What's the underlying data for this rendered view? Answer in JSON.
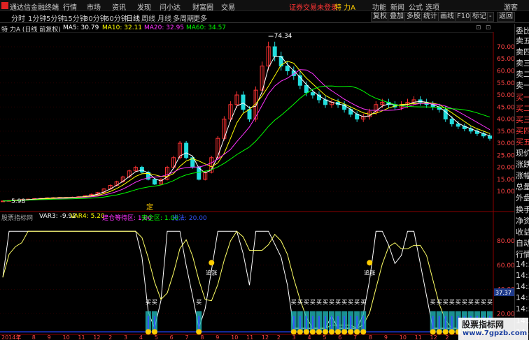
{
  "app": {
    "title": "通达信金融终端",
    "menu": [
      "行情",
      "市场",
      "资讯",
      "发现",
      "问小达",
      "财富圈",
      "交易"
    ],
    "login_status": "证券交易未登录",
    "stock_name": "特 力A",
    "right_menu": [
      "功能",
      "新闻",
      "公式",
      "选项",
      "游客"
    ]
  },
  "toolbar": {
    "periods": [
      "分时",
      "1分钟",
      "5分钟",
      "15分钟",
      "30分钟",
      "60分钟",
      "日线",
      "周线",
      "月线",
      "多周期",
      "更多"
    ],
    "active_period": "日线",
    "buttons": [
      "复权",
      "叠加",
      "多股",
      "统计",
      "画线",
      "F10",
      "标记",
      "-",
      "返回"
    ]
  },
  "main_info": {
    "title": "特 力A (日线 前复权)",
    "ma5": "MA5: 30.79",
    "ma10": "MA10: 32.11",
    "ma20": "MA20: 32.95",
    "ma60": "MA60: 34.57",
    "ma5_color": "#ffffff",
    "ma10_color": "#ffff00",
    "ma20_color": "#ff33ff",
    "ma60_color": "#00ff00"
  },
  "chart_data": {
    "type": "candlestick",
    "price_axis": [
      "70.00",
      "65.00",
      "60.00",
      "55.00",
      "50.00",
      "45.00",
      "40.00",
      "35.00",
      "30.00",
      "25.00",
      "20.00",
      "15.00",
      "10.00"
    ],
    "high_label": "74.34",
    "low_label": "5.98",
    "current_price_label": "37.37",
    "marker": "定",
    "close_series": [
      6.0,
      6.2,
      6.4,
      6.6,
      6.8,
      7.0,
      7.1,
      7.3,
      7.4,
      7.5,
      7.5,
      7.6,
      7.8,
      8.2,
      8.8,
      9.5,
      11.0,
      12.5,
      14.0,
      16.0,
      18.5,
      20.0,
      18.0,
      15.0,
      13.0,
      15.0,
      20.0,
      24.0,
      30.0,
      24.0,
      20.0,
      15.0,
      18.0,
      24.0,
      32.0,
      40.0,
      46.0,
      50.0,
      44.0,
      40.0,
      52.0,
      62.0,
      70.0,
      66.0,
      62.0,
      60.0,
      58.0,
      54.0,
      51.0,
      50.0,
      48.0,
      46.0,
      47.0,
      46.0,
      44.0,
      42.0,
      40.0,
      41.0,
      43.0,
      46.0,
      47.0,
      46.0,
      45.0,
      46.0,
      47.0,
      48.0,
      47.0,
      46.0,
      45.0,
      44.0,
      40.0,
      38.0,
      37.0,
      36.0,
      35.0,
      34.0,
      33.0,
      32.0
    ]
  },
  "indicator": {
    "name": "股票指标网",
    "var3": "VAR3: -9.92",
    "var4": "VAR4: 5.20",
    "wait_zone": "建仓等待区: 1.00",
    "safe_zone": "安全区: 1.00",
    "danger": "光法: 20.00",
    "axis": [
      "80.00",
      "60.00",
      "40.00",
      "20.00"
    ],
    "current_value": "37.37",
    "chase_label": "追涨",
    "buy_label": "买",
    "chase_signals": 9,
    "buy_signals": 11
  },
  "time_axis": [
    "2014年",
    "7",
    "8",
    "9",
    "10",
    "11",
    "12",
    "2",
    "3",
    "4",
    "5",
    "6",
    "7",
    "8",
    "9",
    "10",
    "11",
    "12",
    "2",
    "3",
    "4",
    "5",
    "6",
    "7",
    "8",
    "9",
    "10",
    "11",
    "12",
    "2",
    "3",
    "4"
  ],
  "right_panel": {
    "header": "委比",
    "items": [
      "卖五",
      "卖四",
      "卖三",
      "卖二",
      "卖一",
      "买一",
      "买二",
      "买三",
      "买四",
      "买五",
      "现价",
      "涨跌",
      "涨幅",
      "总量",
      "外盘",
      "换手",
      "净资",
      "收益",
      "自动",
      "行情",
      "14:5",
      "14:5",
      "14:5",
      "14:5",
      "14:5",
      "14:5",
      "14:5"
    ]
  },
  "watermark": {
    "name": "股票指标网",
    "url": "www.7gpzb.com"
  }
}
